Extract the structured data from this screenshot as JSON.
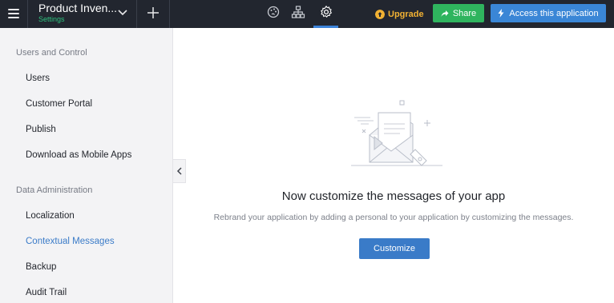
{
  "app": {
    "title": "Product Inven...",
    "subtitle": "Settings"
  },
  "header": {
    "upgrade_label": "Upgrade",
    "share_label": "Share",
    "access_label": "Access this application",
    "tabs": [
      {
        "icon": "palette-icon"
      },
      {
        "icon": "sitemap-icon"
      },
      {
        "icon": "gear-icon",
        "active": true
      }
    ]
  },
  "sidebar": {
    "sections": [
      {
        "heading": "Users and Control",
        "items": [
          {
            "label": "Users"
          },
          {
            "label": "Customer Portal"
          },
          {
            "label": "Publish"
          },
          {
            "label": "Download as Mobile Apps"
          }
        ]
      },
      {
        "heading": "Data Administration",
        "items": [
          {
            "label": "Localization"
          },
          {
            "label": "Contextual Messages",
            "active": true
          },
          {
            "label": "Backup"
          },
          {
            "label": "Audit Trail"
          }
        ]
      }
    ]
  },
  "main": {
    "title": "Now customize the messages of your app",
    "description": "Rebrand your application by adding a personal to your application by customizing the messages.",
    "button_label": "Customize"
  },
  "colors": {
    "topbar": "#22262f",
    "accent": "#3a7bc8",
    "share": "#2fb45e",
    "upgrade": "#f2b233",
    "settings_green": "#2ec27e"
  }
}
